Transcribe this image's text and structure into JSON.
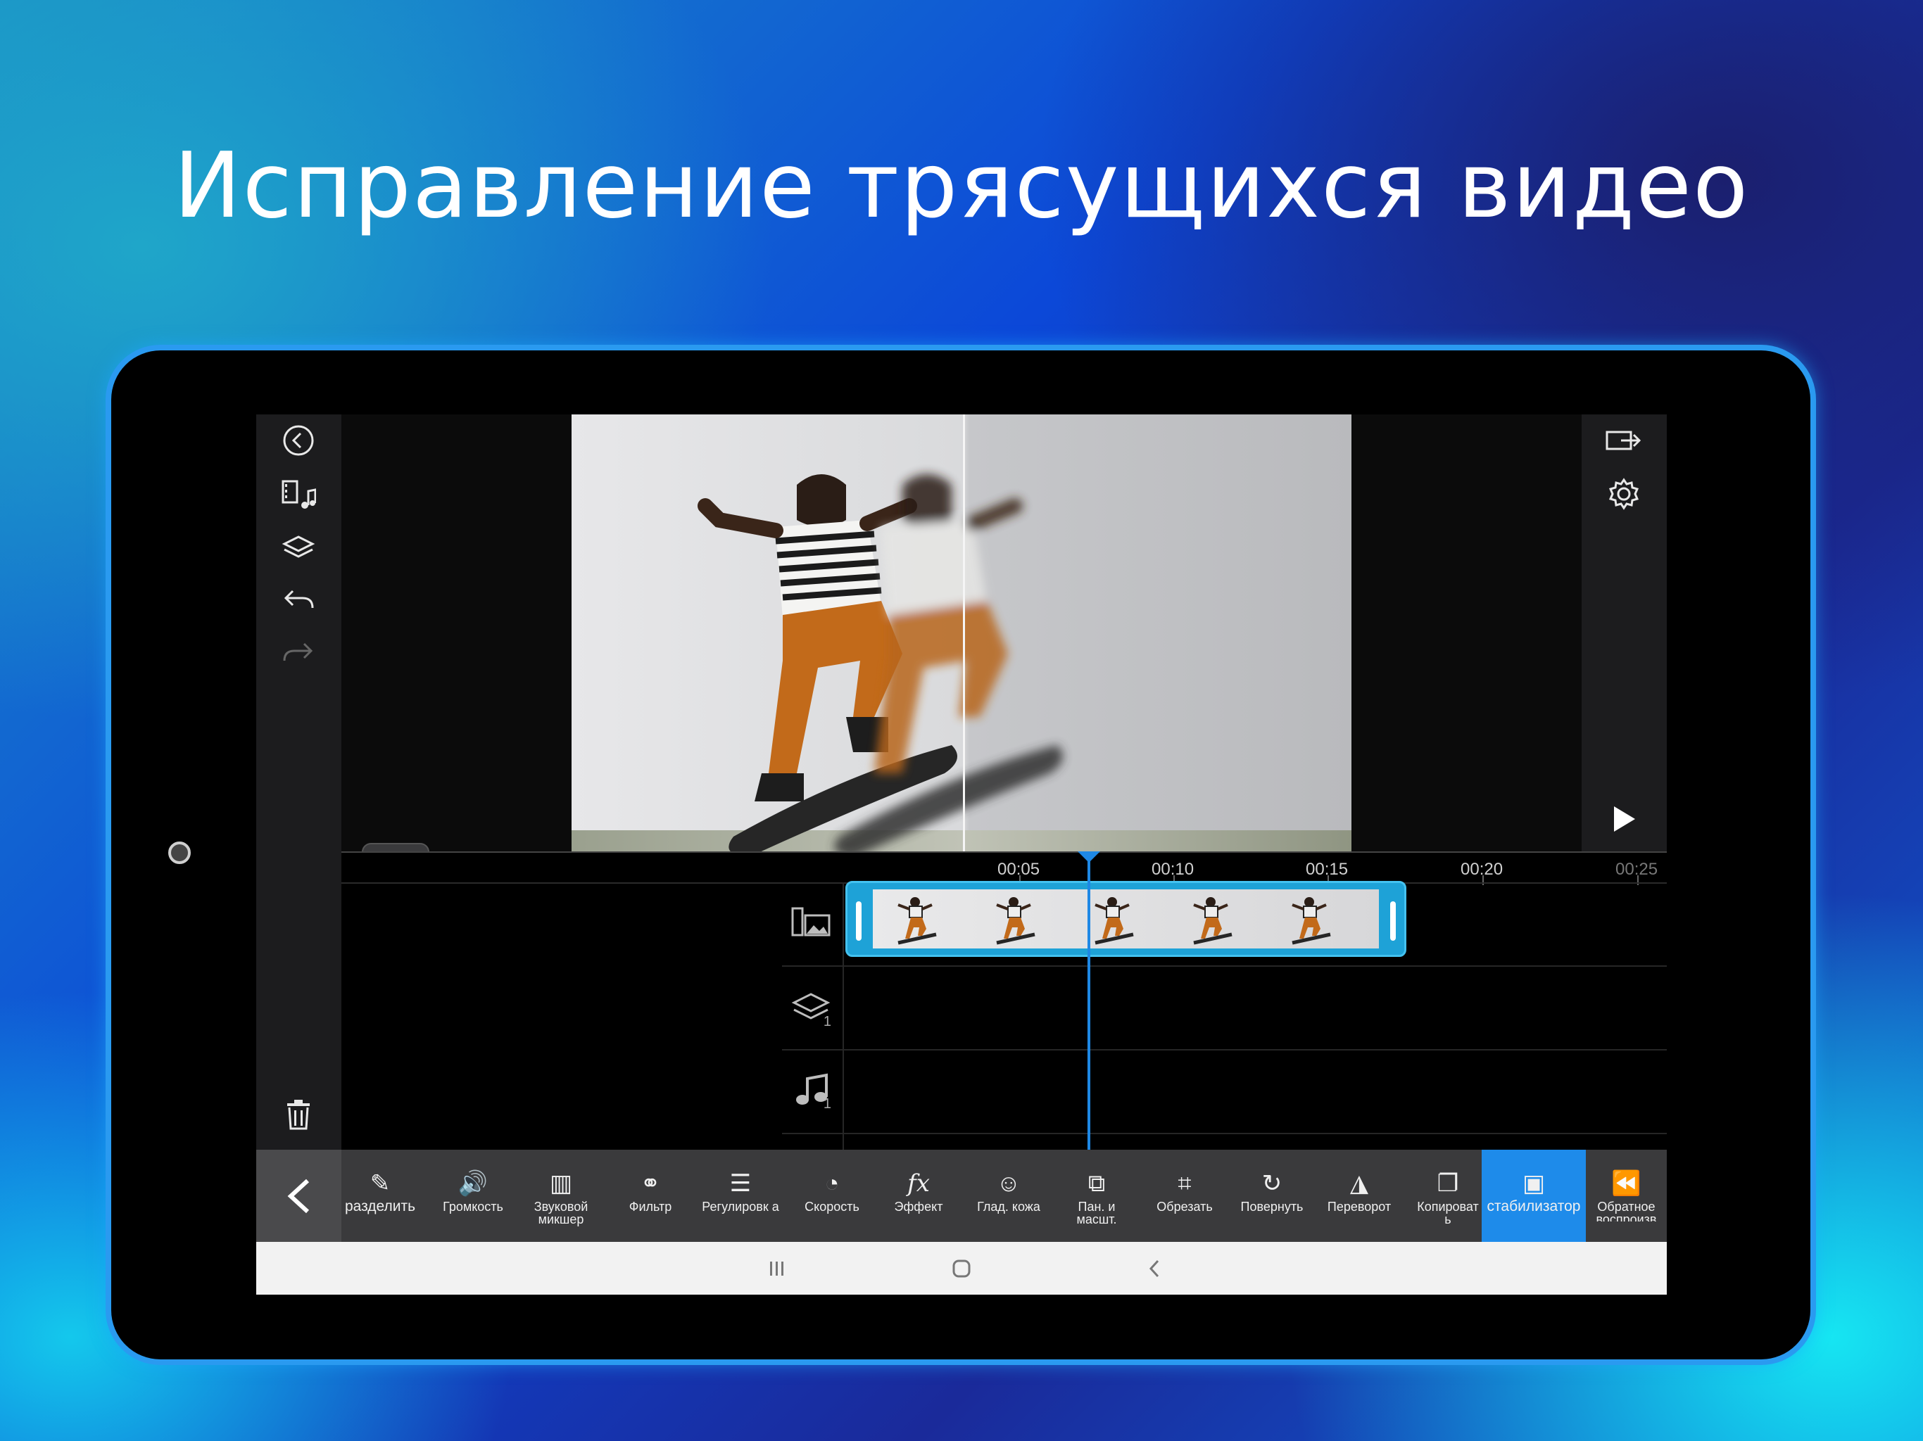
{
  "headline": "Исправление трясущихся видео",
  "left_bar": {
    "icons": [
      "back-circle-icon",
      "media-library-icon",
      "layers-icon",
      "undo-icon",
      "redo-icon",
      "trash-icon"
    ]
  },
  "right_bar": {
    "icons": [
      "export-icon",
      "settings-gear-icon",
      "play-icon"
    ]
  },
  "timeline": {
    "time_labels": [
      "00:05",
      "00:10",
      "00:15",
      "00:20",
      "00:25"
    ],
    "tracks": [
      {
        "icon": "video-image-track-icon",
        "count": ""
      },
      {
        "icon": "layers-track-icon",
        "count": "1"
      },
      {
        "icon": "music-track-icon",
        "count": "1"
      }
    ]
  },
  "toolbar": {
    "tools": [
      {
        "icon": "split-icon",
        "label": "разделить",
        "glyph": "✎"
      },
      {
        "icon": "volume-icon",
        "label": "Громкость",
        "glyph": "🔊"
      },
      {
        "icon": "mixer-icon",
        "label": "Звуковой микшер",
        "glyph": "▥"
      },
      {
        "icon": "filter-icon",
        "label": "Фильтр",
        "glyph": "⚭"
      },
      {
        "icon": "adjust-icon",
        "label": "Регулировк а",
        "glyph": "☰"
      },
      {
        "icon": "speed-icon",
        "label": "Скорость",
        "glyph": "◔"
      },
      {
        "icon": "effect-icon",
        "label": "Эффект",
        "glyph": "fx"
      },
      {
        "icon": "skin-smooth-icon",
        "label": "Глад. кожа",
        "glyph": "☺"
      },
      {
        "icon": "pan-zoom-icon",
        "label": "Пан. и масшт.",
        "glyph": "⧉"
      },
      {
        "icon": "crop-icon",
        "label": "Обрезать",
        "glyph": "⌗"
      },
      {
        "icon": "rotate-icon",
        "label": "Повернуть",
        "glyph": "↻"
      },
      {
        "icon": "flip-icon",
        "label": "Переворот",
        "glyph": "◮"
      },
      {
        "icon": "copy-icon",
        "label": "Копироват ь",
        "glyph": "❐"
      },
      {
        "icon": "stabilizer-icon",
        "label": "стабилизатор",
        "glyph": "▣",
        "active": true
      },
      {
        "icon": "reverse-playback-icon",
        "label": "Обратное воспроизв",
        "glyph": "⏪"
      }
    ]
  },
  "colors": {
    "accent": "#1e8bea",
    "clip": "#1ea2d7",
    "toolbar_bg": "#3a3a3c",
    "sidebar_bg": "#1c1c1e"
  }
}
